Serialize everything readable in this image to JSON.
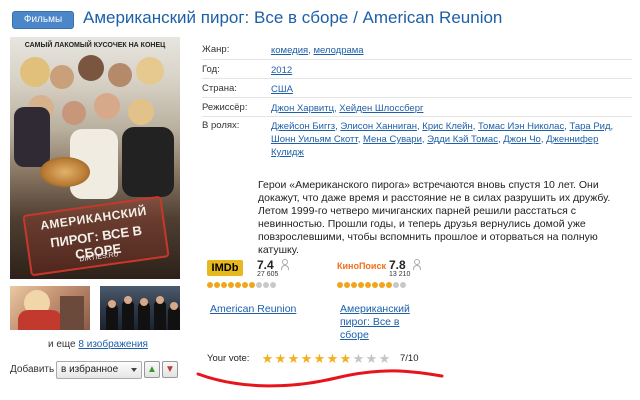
{
  "header": {
    "badge": "Фильмы",
    "title": "Американский пирог: Все в сборе / American Reunion"
  },
  "poster": {
    "tagline": "САМЫЙ ЛАКОМЫЙ КУСОЧЕК НА КОНЕЦ",
    "stamp_line1": "АМЕРИКАНСКИЙ",
    "stamp_line2": "ПИРОГ: ВСЕ В СБОРЕ",
    "stamp_line3": "DIRTIES.RU"
  },
  "gallery": {
    "more_prefix": "и еще",
    "more_link": "8 изображения"
  },
  "add": {
    "label": "Добавить",
    "selected": "в избранное",
    "like_icon": "thumbs-up-icon",
    "dislike_icon": "thumbs-down-icon"
  },
  "info": {
    "genre_label": "Жанр:",
    "genres": [
      "комедия",
      "мелодрама"
    ],
    "year_label": "Год:",
    "year": "2012",
    "country_label": "Страна:",
    "country": "США",
    "director_label": "Режиссёр:",
    "directors": [
      "Джон Харвитц",
      "Хейден Шлоссберг"
    ],
    "cast_label": "В ролях:",
    "cast": [
      "Джейсон Биггз",
      "Элисон Ханниган",
      "Крис Клейн",
      "Томас Иэн Николас",
      "Тара Рид",
      "Шонн Уильям Скотт",
      "Мена Сувари",
      "Эдди Кэй Томас",
      "Джон Чо",
      "Дженнифер Кулидж"
    ]
  },
  "description": "Герои «Американского пирога» встречаются вновь спустя 10 лет. Они докажут, что даже время и расстояние не в силах разрушить их дружбу. Летом 1999-го четверо мичиганских парней решили расстаться с невинностью. Прошли годы, и теперь друзья вернулись домой уже повзрослевшими, чтобы вспомнить прошлое и оторваться на полную катушку.",
  "ratings": [
    {
      "source": "IMDb",
      "score": "7.4",
      "votes": "27 605",
      "stars_filled": 7,
      "stars_total": 10,
      "link": "American Reunion"
    },
    {
      "source": "КиноПоиск",
      "score": "7.8",
      "votes": "13 210",
      "stars_filled": 8,
      "stars_total": 10,
      "link": "Американский пирог: Все в сборе"
    }
  ],
  "your_vote": {
    "label": "Your vote:",
    "stars_filled": 7,
    "stars_total": 10,
    "value": "7/10"
  },
  "colors": {
    "link": "#1d5fa8",
    "badge": "#4a86c8",
    "imdb": "#e6b91e",
    "kinopoisk": "#f06d19",
    "star": "#f2b01e",
    "annotation": "#e8141b"
  }
}
